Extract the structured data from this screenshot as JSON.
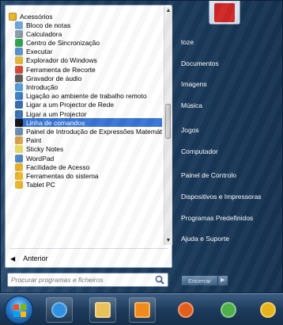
{
  "programs": {
    "folder_header": "Acessórios",
    "items": [
      {
        "label": "Bloco de notas",
        "icon": "notepad-icon",
        "color": "#6fa4d8",
        "selected": false
      },
      {
        "label": "Calculadora",
        "icon": "calculator-icon",
        "color": "#8a9aa8",
        "selected": false
      },
      {
        "label": "Centro de Sincronização",
        "icon": "sync-center-icon",
        "color": "#2fa84f",
        "selected": false
      },
      {
        "label": "Executar",
        "icon": "run-icon",
        "color": "#5b8fcf",
        "selected": false
      },
      {
        "label": "Explorador do Windows",
        "icon": "windows-explorer-icon",
        "color": "#e1b43a",
        "selected": false
      },
      {
        "label": "Ferramenta de Recorte",
        "icon": "snipping-tool-icon",
        "color": "#d24b3a",
        "selected": false
      },
      {
        "label": "Gravador de áudio",
        "icon": "microphone-icon",
        "color": "#5d5d5d",
        "selected": false
      },
      {
        "label": "Introdução",
        "icon": "getting-started-icon",
        "color": "#4e9ad9",
        "selected": false
      },
      {
        "label": "Ligação ao ambiente de trabalho remoto",
        "icon": "remote-desktop-icon",
        "color": "#3c7fc4",
        "selected": false
      },
      {
        "label": "Ligar a um Projector de Rede",
        "icon": "network-projector-icon",
        "color": "#3a6fb0",
        "selected": false
      },
      {
        "label": "Ligar a um Projector",
        "icon": "projector-icon",
        "color": "#3a6fb0",
        "selected": false
      },
      {
        "label": "Linha de comandos",
        "icon": "command-prompt-icon",
        "color": "#111111",
        "selected": true
      },
      {
        "label": "Painel de Introdução de Expressões Matemáticas",
        "icon": "math-input-icon",
        "color": "#6d8fb5",
        "selected": false
      },
      {
        "label": "Paint",
        "icon": "paint-icon",
        "color": "#d8a24a",
        "selected": false
      },
      {
        "label": "Sticky Notes",
        "icon": "sticky-notes-icon",
        "color": "#e6d85a",
        "selected": false
      },
      {
        "label": "WordPad",
        "icon": "wordpad-icon",
        "color": "#4f87c8",
        "selected": false
      },
      {
        "label": "Facilidade de Acesso",
        "icon": "folder-icon",
        "color": "#e8b52b",
        "selected": false
      },
      {
        "label": "Ferramentas do sistema",
        "icon": "folder-icon",
        "color": "#e8b52b",
        "selected": false
      },
      {
        "label": "Tablet PC",
        "icon": "folder-icon",
        "color": "#e8b52b",
        "selected": false
      }
    ],
    "back_label": "Anterior"
  },
  "search": {
    "placeholder": "Procurar programas e ficheiros"
  },
  "right_pane": {
    "items": [
      {
        "label": "toze",
        "name": "user-name"
      },
      {
        "label": "Documentos",
        "name": "link-documentos"
      },
      {
        "label": "Imagens",
        "name": "link-imagens"
      },
      {
        "label": "Música",
        "name": "link-musica"
      },
      {
        "label": "Jogos",
        "name": "link-jogos"
      },
      {
        "label": "Computador",
        "name": "link-computador"
      },
      {
        "label": "Painel de Controlo",
        "name": "link-painel-controlo"
      },
      {
        "label": "Dispositivos e Impressoras",
        "name": "link-dispositivos"
      },
      {
        "label": "Programas Predefinidos",
        "name": "link-programas-predefinidos"
      },
      {
        "label": "Ajuda e Suporte",
        "name": "link-ajuda"
      }
    ],
    "shutdown_label": "Encerrar"
  },
  "taskbar": {
    "buttons": [
      {
        "name": "internet-explorer-icon",
        "color": "#2f8fe0"
      },
      {
        "name": "file-explorer-icon",
        "color": "#e8c15a"
      },
      {
        "name": "media-player-icon",
        "color": "#f08a1c"
      },
      {
        "name": "firefox-icon",
        "color": "#e35d1c"
      },
      {
        "name": "messenger-icon",
        "color": "#4fb04a"
      },
      {
        "name": "chrome-icon",
        "color": "#e8b31a"
      }
    ]
  },
  "colors": {
    "selection": "#3875d7",
    "menu_dark": "#1d3d5f",
    "user_picture": "#d02626"
  }
}
